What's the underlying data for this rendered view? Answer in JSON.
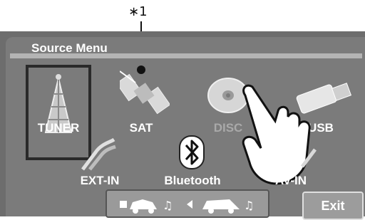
{
  "annotation": {
    "footnote": "∗1"
  },
  "screen": {
    "title": "Source Menu"
  },
  "sources": [
    {
      "label": "TUNER",
      "icon": "tower-icon"
    },
    {
      "label": "SAT",
      "icon": "satellite-icon"
    },
    {
      "label": "DISC",
      "icon": "disc-icon"
    },
    {
      "label": "USB",
      "icon": "usb-icon"
    },
    {
      "label": "EXT-IN",
      "icon": "cable-icon"
    },
    {
      "label": "Bluetooth",
      "icon": "bluetooth-icon"
    },
    {
      "label": "AV-IN",
      "icon": "av-cable-icon"
    }
  ],
  "footer": {
    "exit_label": "Exit"
  },
  "colors": {
    "screen": "#7b7b7b",
    "label": "#ffffff",
    "disabled_label": "#a9a9a9"
  }
}
